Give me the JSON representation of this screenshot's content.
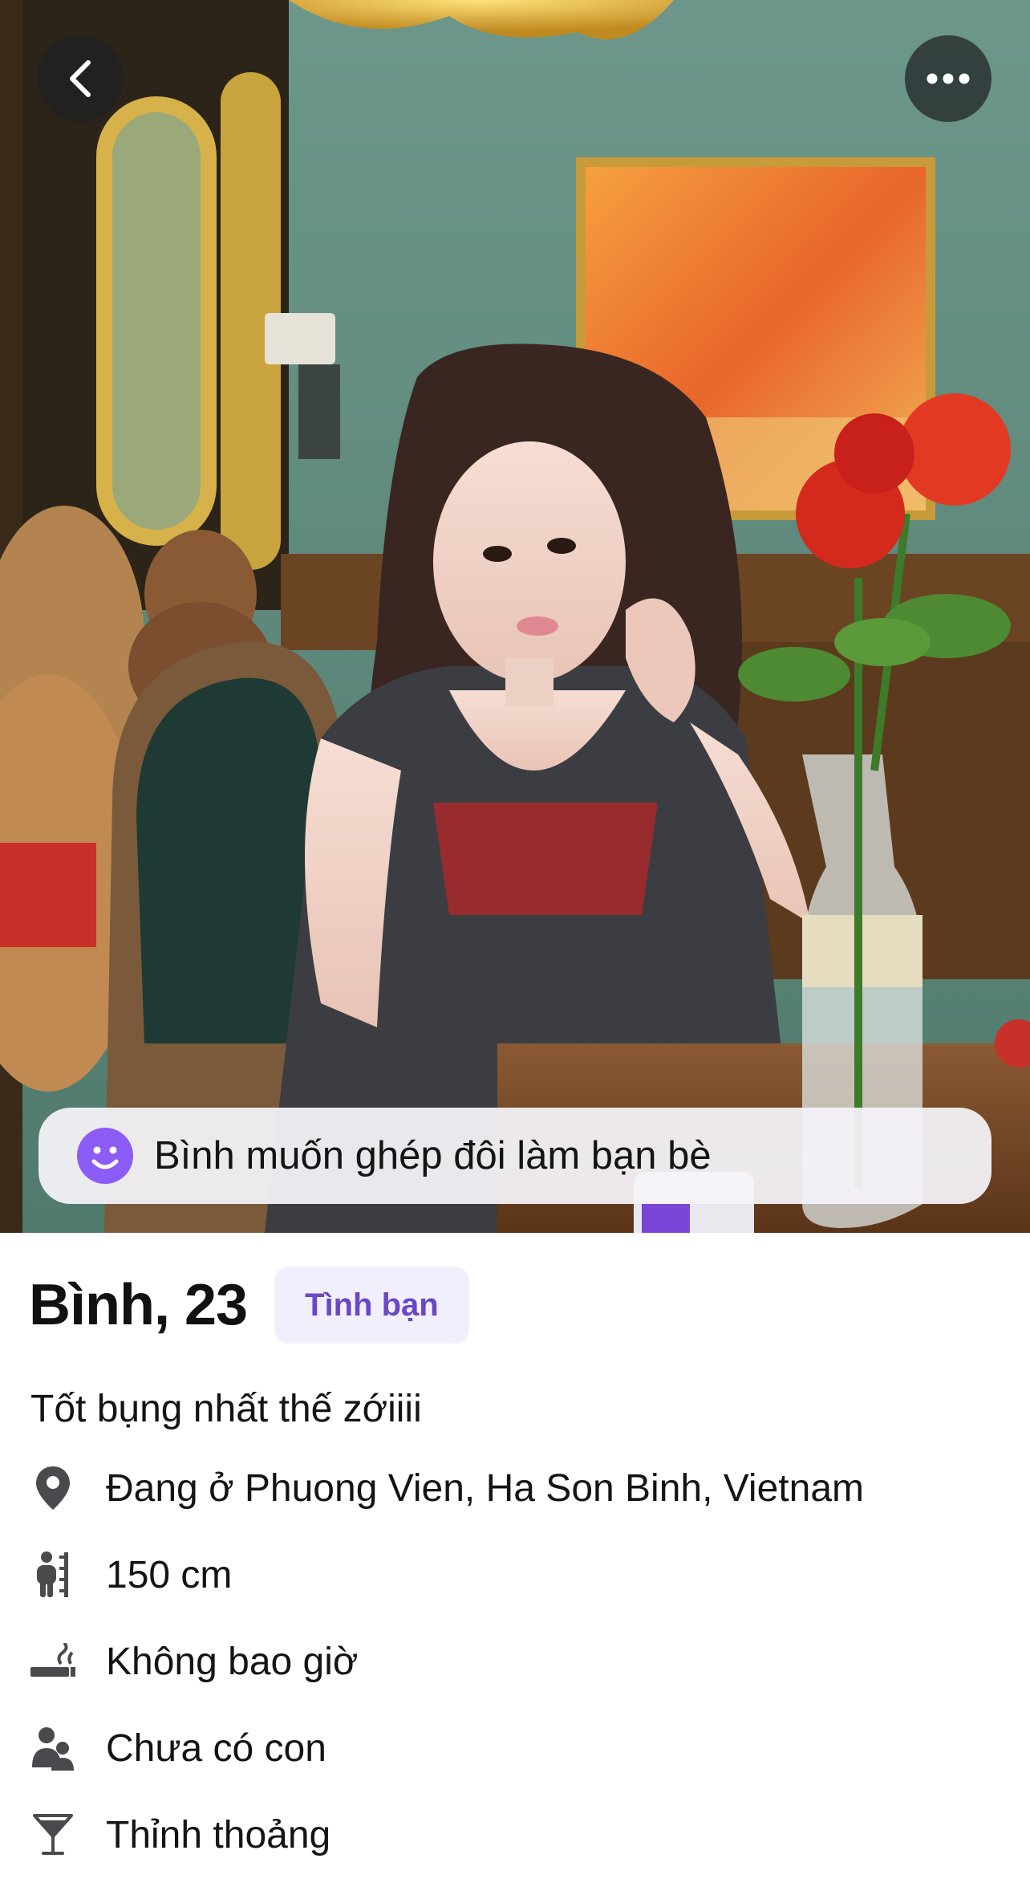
{
  "header": {
    "back_icon": "chevron-left-icon",
    "more_icon": "ellipsis-horizontal-icon"
  },
  "photo": {
    "description_icon": "profile-photo"
  },
  "intent_banner": {
    "icon": "smiley-face-icon",
    "text": "Bình muốn ghép đôi làm bạn bè",
    "icon_color": "#8b5cf6"
  },
  "profile": {
    "name_age": "Bình, 23",
    "tag": "Tình bạn",
    "tag_color": "#6947c7",
    "bio": "Tốt bụng nhất thế zớiiii",
    "attributes": [
      {
        "icon": "location-pin-icon",
        "text": "Đang ở Phuong Vien, Ha Son Binh, Vietnam"
      },
      {
        "icon": "height-icon",
        "text": "150 cm"
      },
      {
        "icon": "smoking-icon",
        "text": "Không bao giờ"
      },
      {
        "icon": "children-icon",
        "text": "Chưa có con"
      },
      {
        "icon": "cocktail-icon",
        "text": "Thỉnh thoảng"
      }
    ]
  }
}
